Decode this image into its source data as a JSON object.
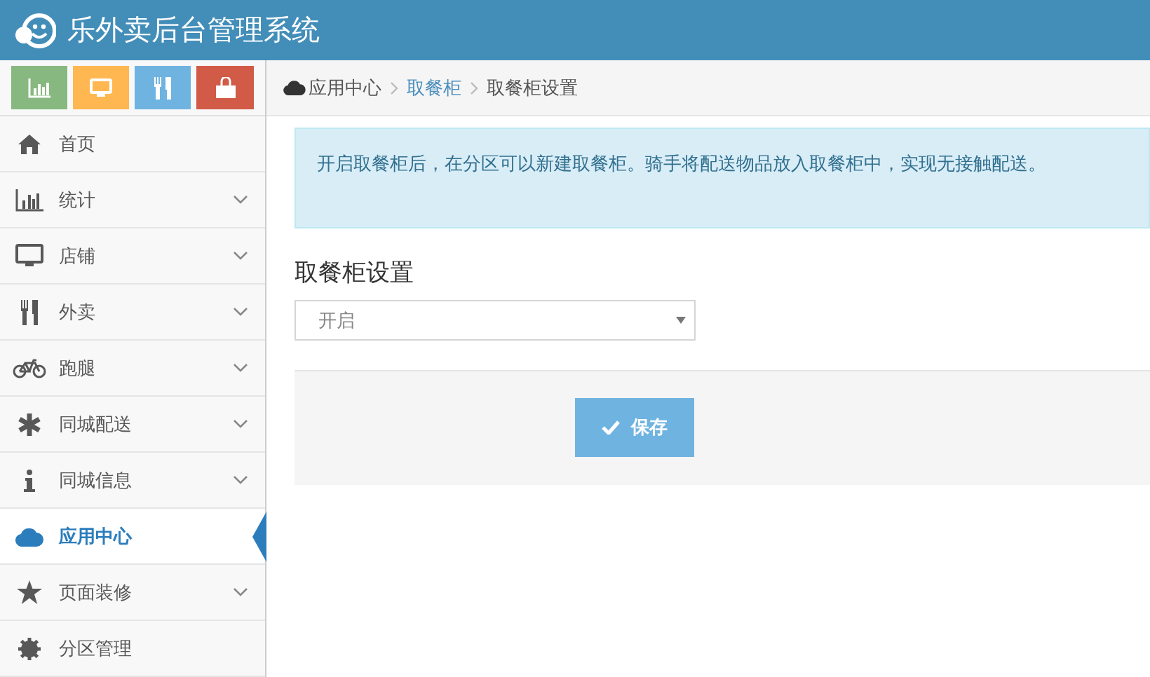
{
  "header": {
    "title": "乐外卖后台管理系统"
  },
  "shortcuts": [
    {
      "color": "#87b87f"
    },
    {
      "color": "#ffb752"
    },
    {
      "color": "#6fb3e0"
    },
    {
      "color": "#d15b47"
    }
  ],
  "sidebar": {
    "items": [
      {
        "label": "首页",
        "expandable": false,
        "selected": false
      },
      {
        "label": "统计",
        "expandable": true,
        "selected": false
      },
      {
        "label": "店铺",
        "expandable": true,
        "selected": false
      },
      {
        "label": "外卖",
        "expandable": true,
        "selected": false
      },
      {
        "label": "跑腿",
        "expandable": true,
        "selected": false
      },
      {
        "label": "同城配送",
        "expandable": true,
        "selected": false
      },
      {
        "label": "同城信息",
        "expandable": true,
        "selected": false
      },
      {
        "label": "应用中心",
        "expandable": false,
        "selected": true
      },
      {
        "label": "页面装修",
        "expandable": true,
        "selected": false
      },
      {
        "label": "分区管理",
        "expandable": false,
        "selected": false
      }
    ]
  },
  "breadcrumb": [
    {
      "label": "应用中心",
      "kind": "home"
    },
    {
      "label": "取餐柜",
      "kind": "link"
    },
    {
      "label": "取餐柜设置",
      "kind": "current"
    }
  ],
  "alert": {
    "text": "开启取餐柜后，在分区可以新建取餐柜。骑手将配送物品放入取餐柜中，实现无接触配送。"
  },
  "form": {
    "heading": "取餐柜设置",
    "select": {
      "value": "开启"
    },
    "save_button": "保存"
  }
}
